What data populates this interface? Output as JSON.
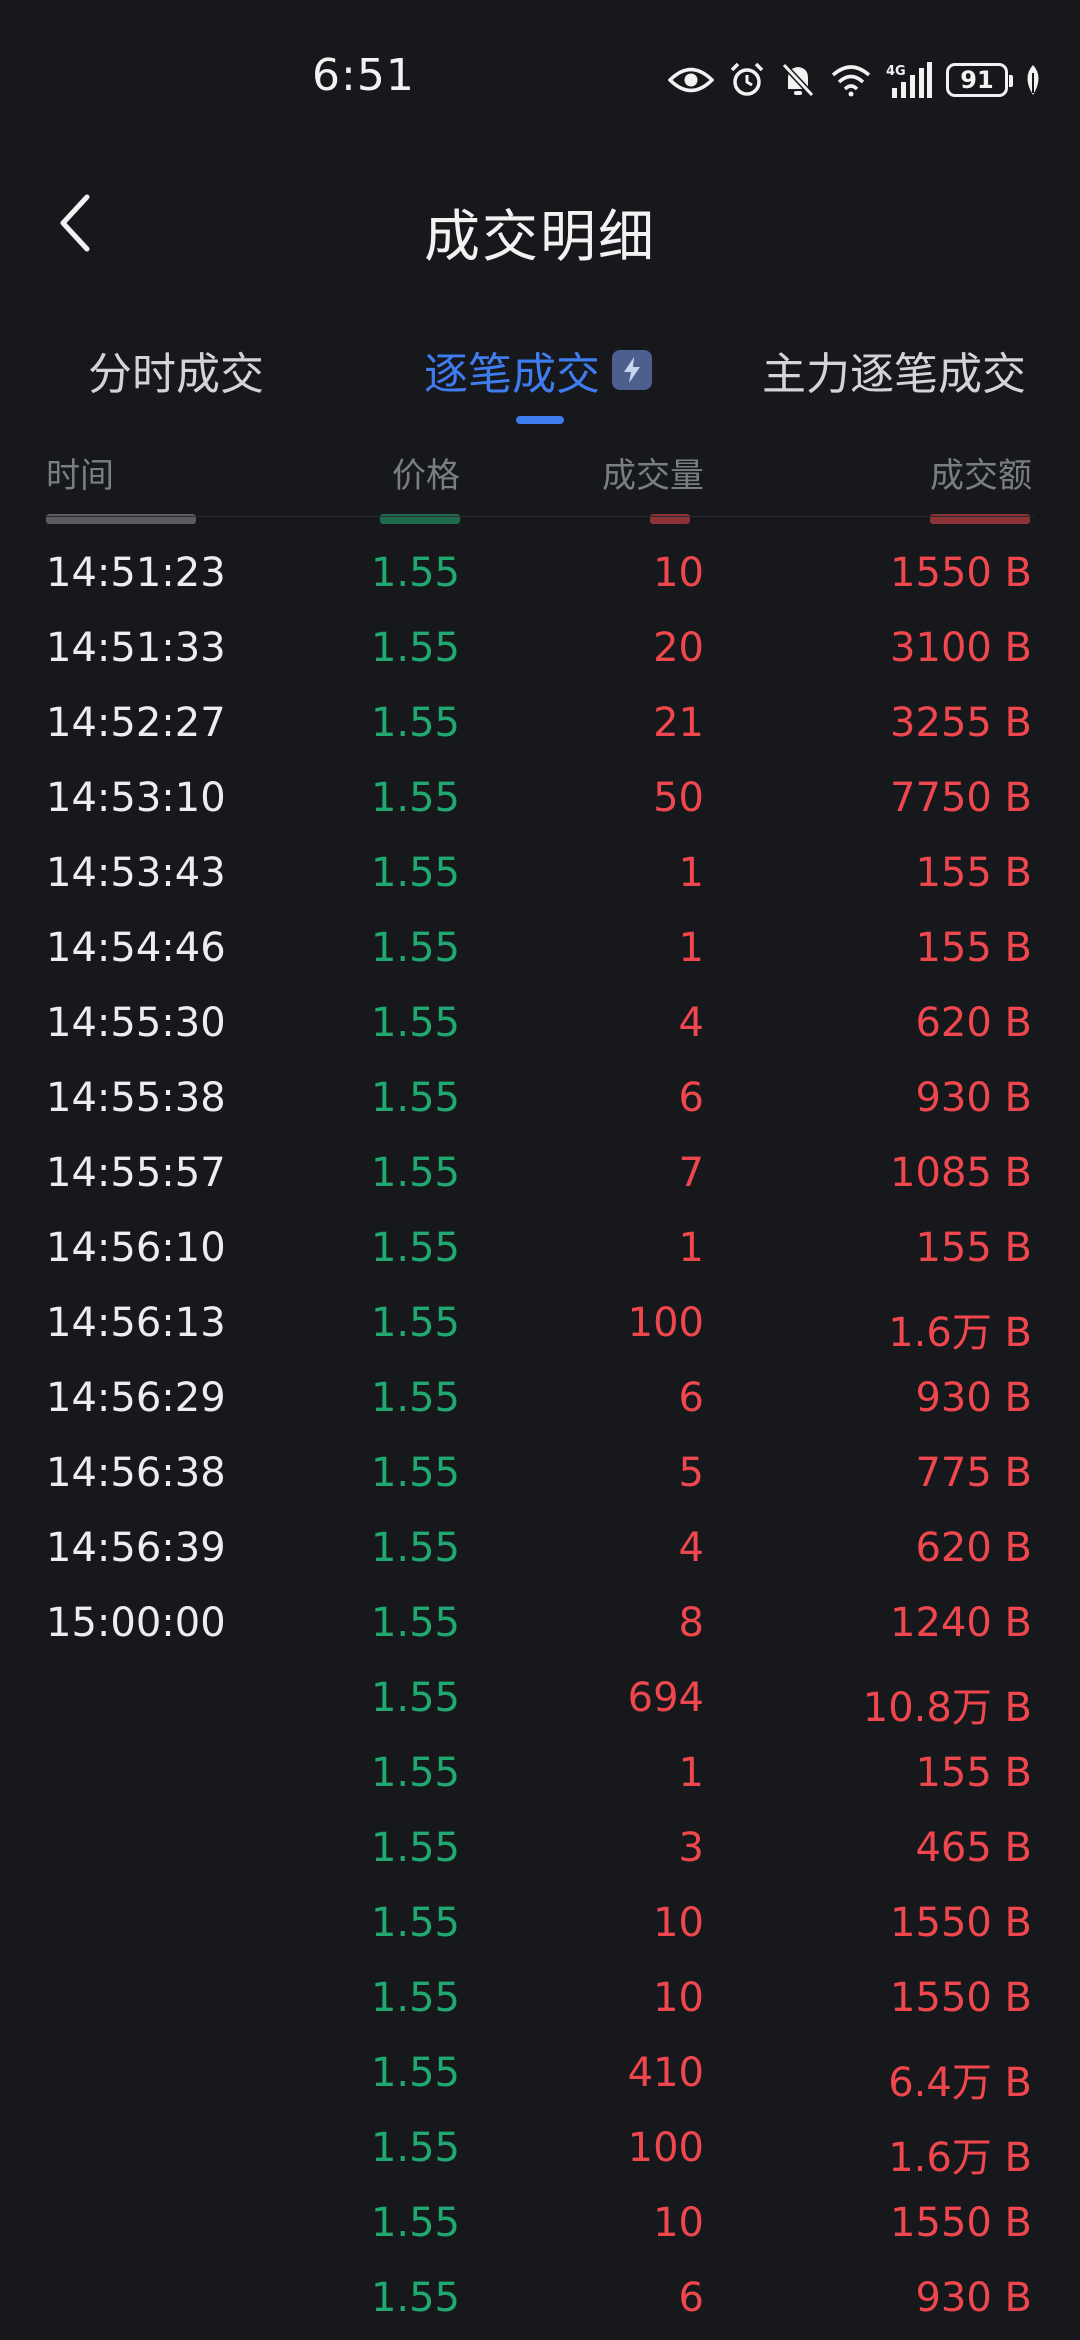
{
  "status_bar": {
    "time": "6:51",
    "battery": "91",
    "network": "4G",
    "icons": [
      "eye-icon",
      "alarm-icon",
      "bell-off-icon",
      "wifi-icon",
      "signal-icon",
      "battery-icon",
      "leaf-icon"
    ]
  },
  "header": {
    "title": "成交明细",
    "back_icon": "chevron-left-icon"
  },
  "tabs": [
    {
      "label": "分时成交",
      "active": false
    },
    {
      "label": "逐笔成交",
      "active": true,
      "badge_icon": "lightning-icon"
    },
    {
      "label": "主力逐笔成交",
      "active": false
    }
  ],
  "columns": {
    "time": "时间",
    "price": "价格",
    "volume": "成交量",
    "amount": "成交额"
  },
  "colors": {
    "background": "#17181b",
    "accent": "#3e7cf0",
    "price_green": "#1fa971",
    "value_red": "#f0474f",
    "header_gray": "#7b7d84"
  },
  "trades": [
    {
      "time": "14:51:23",
      "price": "1.55",
      "volume": "10",
      "amount": "1550 B"
    },
    {
      "time": "14:51:33",
      "price": "1.55",
      "volume": "20",
      "amount": "3100 B"
    },
    {
      "time": "14:52:27",
      "price": "1.55",
      "volume": "21",
      "amount": "3255 B"
    },
    {
      "time": "14:53:10",
      "price": "1.55",
      "volume": "50",
      "amount": "7750 B"
    },
    {
      "time": "14:53:43",
      "price": "1.55",
      "volume": "1",
      "amount": "155 B"
    },
    {
      "time": "14:54:46",
      "price": "1.55",
      "volume": "1",
      "amount": "155 B"
    },
    {
      "time": "14:55:30",
      "price": "1.55",
      "volume": "4",
      "amount": "620 B"
    },
    {
      "time": "14:55:38",
      "price": "1.55",
      "volume": "6",
      "amount": "930 B"
    },
    {
      "time": "14:55:57",
      "price": "1.55",
      "volume": "7",
      "amount": "1085 B"
    },
    {
      "time": "14:56:10",
      "price": "1.55",
      "volume": "1",
      "amount": "155 B"
    },
    {
      "time": "14:56:13",
      "price": "1.55",
      "volume": "100",
      "amount": "1.6万 B"
    },
    {
      "time": "14:56:29",
      "price": "1.55",
      "volume": "6",
      "amount": "930 B"
    },
    {
      "time": "14:56:38",
      "price": "1.55",
      "volume": "5",
      "amount": "775 B"
    },
    {
      "time": "14:56:39",
      "price": "1.55",
      "volume": "4",
      "amount": "620 B"
    },
    {
      "time": "15:00:00",
      "price": "1.55",
      "volume": "8",
      "amount": "1240 B"
    },
    {
      "time": "",
      "price": "1.55",
      "volume": "694",
      "amount": "10.8万 B"
    },
    {
      "time": "",
      "price": "1.55",
      "volume": "1",
      "amount": "155 B"
    },
    {
      "time": "",
      "price": "1.55",
      "volume": "3",
      "amount": "465 B"
    },
    {
      "time": "",
      "price": "1.55",
      "volume": "10",
      "amount": "1550 B"
    },
    {
      "time": "",
      "price": "1.55",
      "volume": "10",
      "amount": "1550 B"
    },
    {
      "time": "",
      "price": "1.55",
      "volume": "410",
      "amount": "6.4万 B"
    },
    {
      "time": "",
      "price": "1.55",
      "volume": "100",
      "amount": "1.6万 B"
    },
    {
      "time": "",
      "price": "1.55",
      "volume": "10",
      "amount": "1550 B"
    },
    {
      "time": "",
      "price": "1.55",
      "volume": "6",
      "amount": "930 B"
    }
  ]
}
